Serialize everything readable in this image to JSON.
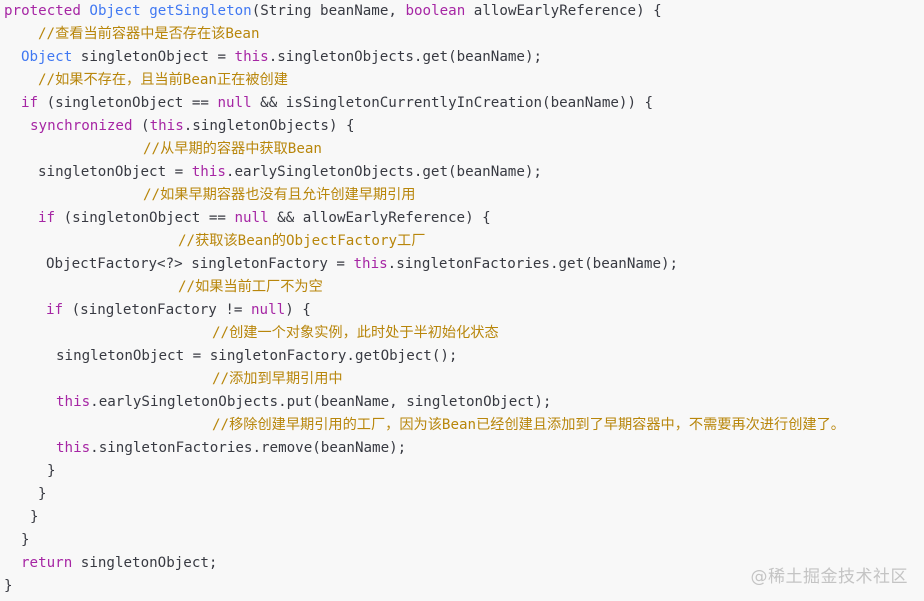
{
  "code_lines": [
    {
      "tokens": [
        {
          "t": "protected",
          "c": "kw"
        },
        {
          "t": " ",
          "c": "pl"
        },
        {
          "t": "Object",
          "c": "ty"
        },
        {
          "t": " ",
          "c": "pl"
        },
        {
          "t": "getSingleton",
          "c": "fn"
        },
        {
          "t": "(String beanName, ",
          "c": "pl"
        },
        {
          "t": "boolean",
          "c": "kw"
        },
        {
          "t": " allowEarlyReference) {",
          "c": "pl"
        }
      ]
    },
    {
      "tokens": [
        {
          "t": "//查看当前容器中是否存在该Bean",
          "c": "cm"
        }
      ]
    },
    {
      "tokens": [
        {
          "t": "Object",
          "c": "ty"
        },
        {
          "t": " singletonObject = ",
          "c": "pl"
        },
        {
          "t": "this",
          "c": "kw"
        },
        {
          "t": ".singletonObjects.get(beanName);",
          "c": "pl"
        }
      ]
    },
    {
      "tokens": [
        {
          "t": "//如果不存在，且当前Bean正在被创建",
          "c": "cm"
        }
      ]
    },
    {
      "tokens": [
        {
          "t": "if",
          "c": "kw"
        },
        {
          "t": " (singletonObject == ",
          "c": "pl"
        },
        {
          "t": "null",
          "c": "kw"
        },
        {
          "t": " && isSingletonCurrentlyInCreation(beanName)) {",
          "c": "pl"
        }
      ]
    },
    {
      "tokens": [
        {
          "t": "synchronized",
          "c": "kw"
        },
        {
          "t": " (",
          "c": "pl"
        },
        {
          "t": "this",
          "c": "kw"
        },
        {
          "t": ".singletonObjects) {",
          "c": "pl"
        }
      ]
    },
    {
      "tokens": [
        {
          "t": "//从早期的容器中获取Bean",
          "c": "cm"
        }
      ]
    },
    {
      "tokens": [
        {
          "t": "singletonObject = ",
          "c": "pl"
        },
        {
          "t": "this",
          "c": "kw"
        },
        {
          "t": ".earlySingletonObjects.get(beanName);",
          "c": "pl"
        }
      ]
    },
    {
      "tokens": [
        {
          "t": "//如果早期容器也没有且允许创建早期引用",
          "c": "cm"
        }
      ]
    },
    {
      "tokens": [
        {
          "t": "if",
          "c": "kw"
        },
        {
          "t": " (singletonObject == ",
          "c": "pl"
        },
        {
          "t": "null",
          "c": "kw"
        },
        {
          "t": " && allowEarlyReference) {",
          "c": "pl"
        }
      ]
    },
    {
      "tokens": [
        {
          "t": "//获取该Bean的ObjectFactory工厂",
          "c": "cm"
        }
      ]
    },
    {
      "tokens": [
        {
          "t": "ObjectFactory<?> singletonFactory = ",
          "c": "pl"
        },
        {
          "t": "this",
          "c": "kw"
        },
        {
          "t": ".singletonFactories.get(beanName);",
          "c": "pl"
        }
      ]
    },
    {
      "tokens": [
        {
          "t": "//如果当前工厂不为空",
          "c": "cm"
        }
      ]
    },
    {
      "tokens": [
        {
          "t": "if",
          "c": "kw"
        },
        {
          "t": " (singletonFactory != ",
          "c": "pl"
        },
        {
          "t": "null",
          "c": "kw"
        },
        {
          "t": ") {",
          "c": "pl"
        }
      ]
    },
    {
      "tokens": [
        {
          "t": "//创建一个对象实例，此时处于半初始化状态",
          "c": "cm"
        }
      ]
    },
    {
      "tokens": [
        {
          "t": "singletonObject = singletonFactory.getObject();",
          "c": "pl"
        }
      ]
    },
    {
      "tokens": [
        {
          "t": "//添加到早期引用中",
          "c": "cm"
        }
      ]
    },
    {
      "tokens": [
        {
          "t": "this",
          "c": "kw"
        },
        {
          "t": ".earlySingletonObjects.put(beanName, singletonObject);",
          "c": "pl"
        }
      ]
    },
    {
      "tokens": [
        {
          "t": "//移除创建早期引用的工厂，因为该Bean已经创建且添加到了早期容器中，不需要再次进行创建了。",
          "c": "cm"
        }
      ]
    },
    {
      "tokens": [
        {
          "t": "this",
          "c": "kw"
        },
        {
          "t": ".singletonFactories.remove(beanName);",
          "c": "pl"
        }
      ]
    },
    {
      "tokens": [
        {
          "t": "}",
          "c": "pl"
        }
      ]
    },
    {
      "tokens": [
        {
          "t": "}",
          "c": "pl"
        }
      ]
    },
    {
      "tokens": [
        {
          "t": "}",
          "c": "pl"
        }
      ]
    },
    {
      "tokens": [
        {
          "t": "}",
          "c": "pl"
        }
      ]
    },
    {
      "tokens": [
        {
          "t": "return",
          "c": "kw"
        },
        {
          "t": " singletonObject;",
          "c": "pl"
        }
      ]
    },
    {
      "tokens": [
        {
          "t": "}",
          "c": "pl"
        }
      ]
    }
  ],
  "watermark": "@稀土掘金技术社区"
}
